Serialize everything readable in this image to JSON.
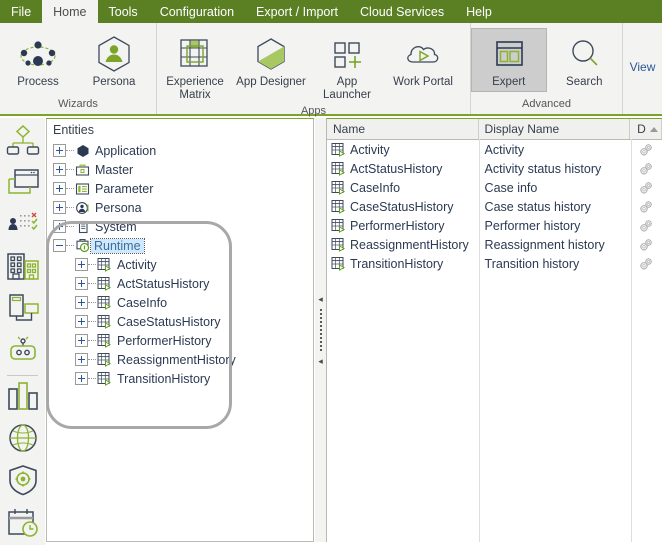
{
  "menu": {
    "items": [
      {
        "label": "File",
        "active": false
      },
      {
        "label": "Home",
        "active": true
      },
      {
        "label": "Tools",
        "active": false
      },
      {
        "label": "Configuration",
        "active": false
      },
      {
        "label": "Export / Import",
        "active": false
      },
      {
        "label": "Cloud Services",
        "active": false
      },
      {
        "label": "Help",
        "active": false
      }
    ]
  },
  "ribbon": {
    "groups": [
      {
        "title": "Wizards",
        "buttons": [
          {
            "label": "Process",
            "icon": "process-network-icon",
            "selected": false
          },
          {
            "label": "Persona",
            "icon": "persona-hexagon-icon",
            "selected": false
          }
        ]
      },
      {
        "title": "Apps",
        "buttons": [
          {
            "label": "Experience Matrix",
            "icon": "experience-matrix-icon",
            "selected": false
          },
          {
            "label": "App Designer",
            "icon": "app-designer-hexagon-icon",
            "selected": false
          },
          {
            "label": "App Launcher",
            "icon": "app-launcher-grid-plus-icon",
            "selected": false
          },
          {
            "label": "Work Portal",
            "icon": "cloud-play-icon",
            "selected": false
          }
        ]
      },
      {
        "title": "Advanced",
        "buttons": [
          {
            "label": "Expert",
            "icon": "expert-window-panes-icon",
            "selected": true
          },
          {
            "label": "Search",
            "icon": "search-magnifier-icon",
            "selected": false
          }
        ]
      },
      {
        "title": "",
        "buttons": [
          {
            "label": "View",
            "icon": "view-icon",
            "selected": false
          }
        ]
      }
    ]
  },
  "rail": {
    "items": [
      {
        "name": "process-diagram-icon"
      },
      {
        "name": "forms-window-icon"
      },
      {
        "name": "rules-checklist-icon"
      },
      {
        "name": "organization-buildings-icon"
      },
      {
        "name": "devices-mobile-desktop-icon"
      },
      {
        "name": "bot-automation-icon"
      },
      {
        "name": "analytics-bars-icon"
      },
      {
        "name": "integration-globe-icon"
      },
      {
        "name": "security-shield-gear-icon"
      },
      {
        "name": "scheduler-calendar-clock-icon"
      }
    ]
  },
  "tree": {
    "header": "Entities",
    "nodes": [
      {
        "label": "Application",
        "depth": 0,
        "expander": "plus",
        "icon": "application-hexagon-icon",
        "selected": false
      },
      {
        "label": "Master",
        "depth": 0,
        "expander": "plus",
        "icon": "master-briefcase-icon",
        "selected": false
      },
      {
        "label": "Parameter",
        "depth": 0,
        "expander": "plus",
        "icon": "parameter-list-icon",
        "selected": false
      },
      {
        "label": "Persona",
        "depth": 0,
        "expander": "plus",
        "icon": "persona-circle-icon",
        "selected": false
      },
      {
        "label": "System",
        "depth": 0,
        "expander": "plus",
        "icon": "system-document-icon",
        "selected": false
      },
      {
        "label": "Runtime",
        "depth": 0,
        "expander": "minus",
        "icon": "runtime-briefcase-icon",
        "selected": true
      },
      {
        "label": "Activity",
        "depth": 1,
        "expander": "plus",
        "icon": "entity-table-icon",
        "selected": false
      },
      {
        "label": "ActStatusHistory",
        "depth": 1,
        "expander": "plus",
        "icon": "entity-table-icon",
        "selected": false
      },
      {
        "label": "CaseInfo",
        "depth": 1,
        "expander": "plus",
        "icon": "entity-table-icon",
        "selected": false
      },
      {
        "label": "CaseStatusHistory",
        "depth": 1,
        "expander": "plus",
        "icon": "entity-table-icon",
        "selected": false
      },
      {
        "label": "PerformerHistory",
        "depth": 1,
        "expander": "plus",
        "icon": "entity-table-icon",
        "selected": false
      },
      {
        "label": "ReassignmentHistory",
        "depth": 1,
        "expander": "plus",
        "icon": "entity-table-icon",
        "selected": false
      },
      {
        "label": "TransitionHistory",
        "depth": 1,
        "expander": "plus",
        "icon": "entity-table-icon",
        "selected": false
      }
    ]
  },
  "splitter": {
    "collapse_left_icon": "triangle-left-icon",
    "collapse_left_icon_2": "triangle-left-icon"
  },
  "grid": {
    "columns": [
      {
        "label": "Name",
        "sorted": false
      },
      {
        "label": "Display Name",
        "sorted": false
      },
      {
        "label": "D",
        "sorted": true,
        "sort_direction": "asc"
      }
    ],
    "rows": [
      {
        "name": "Activity",
        "display_name": "Activity",
        "icon": "entity-table-icon",
        "d_icon": "gears-icon"
      },
      {
        "name": "ActStatusHistory",
        "display_name": "Activity status history",
        "icon": "entity-table-icon",
        "d_icon": "gears-icon"
      },
      {
        "name": "CaseInfo",
        "display_name": "Case info",
        "icon": "entity-table-icon",
        "d_icon": "gears-icon"
      },
      {
        "name": "CaseStatusHistory",
        "display_name": "Case status history",
        "icon": "entity-table-icon",
        "d_icon": "gears-icon"
      },
      {
        "name": "PerformerHistory",
        "display_name": "Performer history",
        "icon": "entity-table-icon",
        "d_icon": "gears-icon"
      },
      {
        "name": "ReassignmentHistory",
        "display_name": "Reassignment history",
        "icon": "entity-table-icon",
        "d_icon": "gears-icon"
      },
      {
        "name": "TransitionHistory",
        "display_name": "Transition history",
        "icon": "entity-table-icon",
        "d_icon": "gears-icon"
      }
    ]
  },
  "colors": {
    "brand_green": "#5b8024",
    "accent_green": "#7ba428",
    "ribbon_bg": "#f3f3f1",
    "text_dark": "#2b3a52",
    "selection_blue": "#cde8ff",
    "annotation_gray": "#a8a8a8"
  }
}
